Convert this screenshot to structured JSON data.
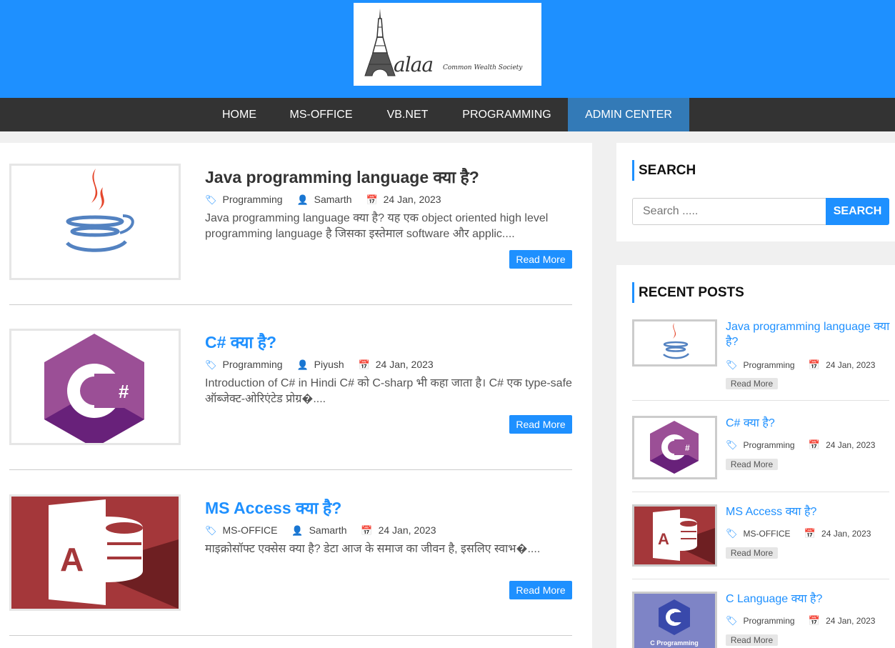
{
  "logo": {
    "text": "alaa",
    "sub": "Common Wealth Society"
  },
  "nav": [
    {
      "label": "HOME"
    },
    {
      "label": "MS-OFFICE"
    },
    {
      "label": "VB.NET"
    },
    {
      "label": "PROGRAMMING"
    },
    {
      "label": "ADMIN CENTER"
    }
  ],
  "posts": [
    {
      "title": "Java programming language क्या है?",
      "category": "Programming",
      "author": "Samarth",
      "date": "24 Jan, 2023",
      "excerpt": "Java programming language क्या है? यह एक object oriented high level programming language है जिसका इस्तेमाल software और applic....",
      "read_more": "Read More",
      "title_color": "#333333"
    },
    {
      "title": "C# क्या है?",
      "category": "Programming",
      "author": "Piyush",
      "date": "24 Jan, 2023",
      "excerpt": "Introduction of C# in Hindi C# को C-sharp भी कहा जाता है। C# एक type-safe ऑब्जेक्ट-ओरिएंटेड प्रोग्र�....",
      "read_more": "Read More",
      "title_color": "#1e90ff"
    },
    {
      "title": "MS Access क्या है?",
      "category": "MS-OFFICE",
      "author": "Samarth",
      "date": "24 Jan, 2023",
      "excerpt": "माइक्रोसॉफ्ट एक्सेस क्या है? डेटा आज के समाज का जीवन है, इसलिए स्वाभ�....",
      "read_more": "Read More",
      "title_color": "#1e90ff"
    }
  ],
  "search": {
    "title": "SEARCH",
    "placeholder": "Search .....",
    "button": "SEARCH"
  },
  "recent": {
    "title": "RECENT POSTS",
    "items": [
      {
        "title": "Java programming language क्या है?",
        "category": "Programming",
        "date": "24 Jan, 2023",
        "read_more": "Read More"
      },
      {
        "title": "C# क्या है?",
        "category": "Programming",
        "date": "24 Jan, 2023",
        "read_more": "Read More"
      },
      {
        "title": "MS Access क्या है?",
        "category": "MS-OFFICE",
        "date": "24 Jan, 2023",
        "read_more": "Read More"
      },
      {
        "title": "C Language क्या है?",
        "category": "Programming",
        "date": "24 Jan, 2023",
        "read_more": "Read More",
        "thumb_caption": "C Programming"
      }
    ]
  },
  "colors": {
    "brand": "#1e90ff",
    "nav_bg": "#333333",
    "nav_active": "#337ab7"
  }
}
